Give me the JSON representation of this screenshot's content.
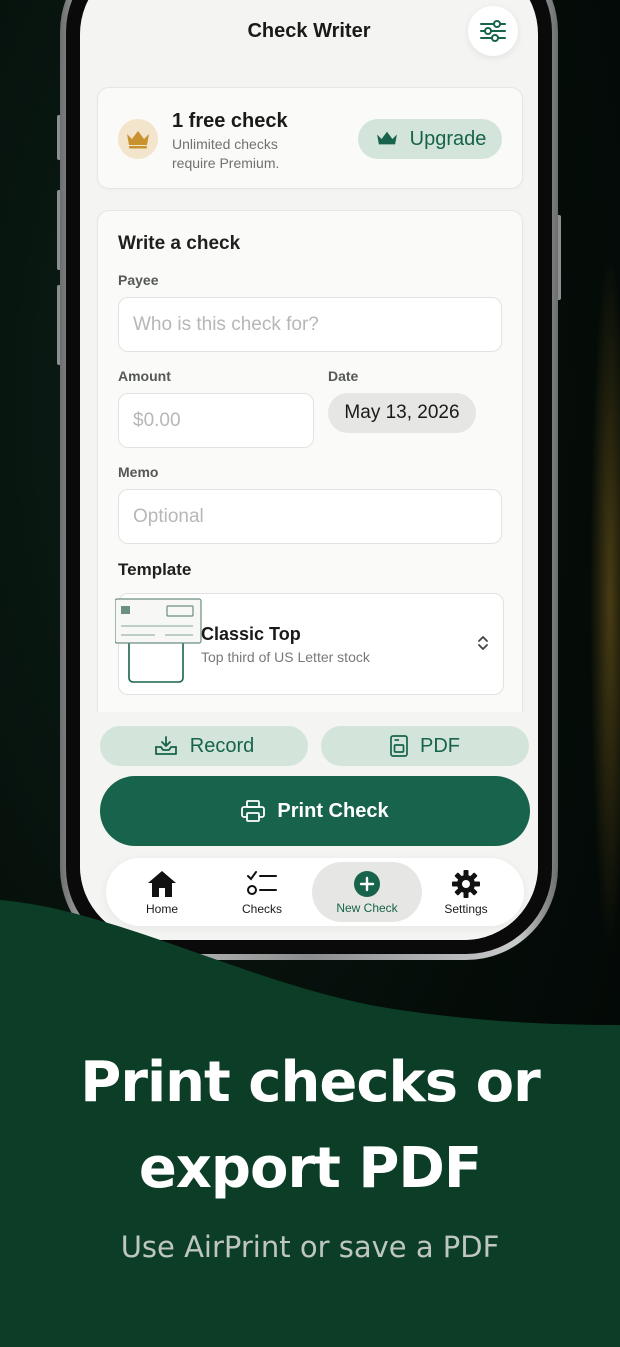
{
  "header": {
    "title": "Check Writer",
    "filter_icon": "sliders-icon"
  },
  "promo": {
    "title": "1 free check",
    "subtitle": "Unlimited checks require Premium.",
    "upgrade_label": "Upgrade",
    "crown_color": "#c8932f"
  },
  "form": {
    "title": "Write a check",
    "payee_label": "Payee",
    "payee_placeholder": "Who is this check for?",
    "amount_label": "Amount",
    "amount_placeholder": "$0.00",
    "date_label": "Date",
    "date_value": "May 13, 2026",
    "memo_label": "Memo",
    "memo_placeholder": "Optional",
    "template_label": "Template",
    "template_name": "Classic Top",
    "template_desc": "Top third of US Letter stock"
  },
  "actions": {
    "record_label": "Record",
    "pdf_label": "PDF",
    "print_label": "Print Check"
  },
  "tabs": [
    {
      "label": "Home",
      "icon": "home-icon"
    },
    {
      "label": "Checks",
      "icon": "checklist-icon"
    },
    {
      "label": "New Check",
      "icon": "plus-circle-icon",
      "active": true
    },
    {
      "label": "Settings",
      "icon": "gear-icon"
    }
  ],
  "marketing": {
    "headline_line1": "Print checks or",
    "headline_line2": "export PDF",
    "subline": "Use AirPrint or save a PDF"
  },
  "colors": {
    "brand": "#17634b",
    "brand_light": "#d3e5da",
    "background": "#f4f5f2",
    "dark_green": "#0b3d27"
  }
}
